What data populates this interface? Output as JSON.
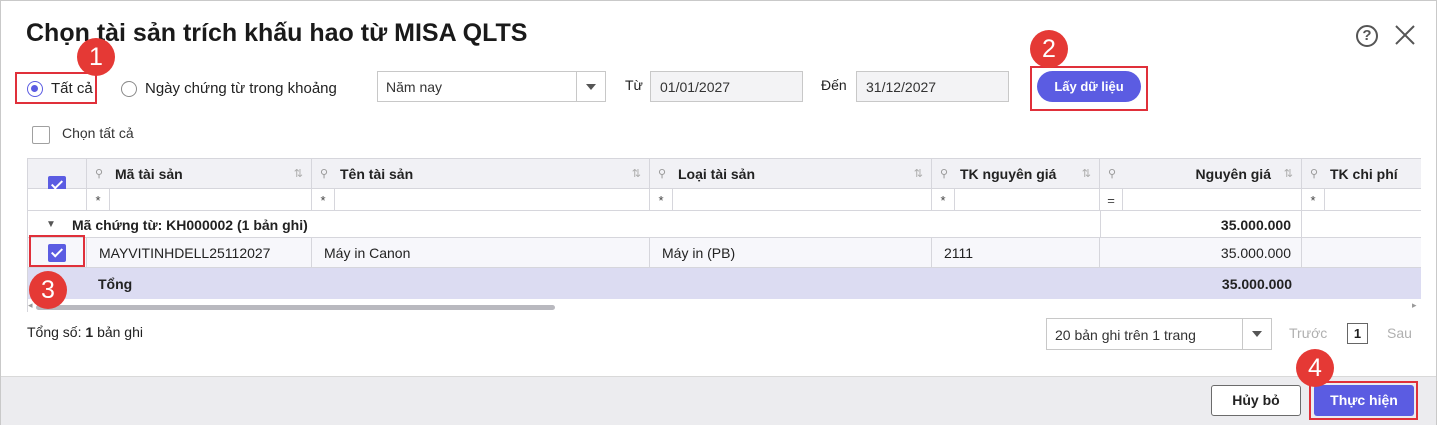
{
  "dialog": {
    "title": "Chọn tài sản trích khấu hao từ MISA QLTS",
    "help_icon": "question-circle-icon",
    "help_glyph": "?",
    "close_icon": "close-icon"
  },
  "filters": {
    "radio_all_label": "Tất cả",
    "radio_range_label": "Ngày chứng từ trong khoảng",
    "period_value": "Năm nay",
    "from_label": "Từ",
    "from_date": "01/01/2027",
    "to_label": "Đến",
    "to_date": "31/12/2027",
    "fetch_button": "Lấy dữ liệu"
  },
  "select_all_label": "Chọn tất cả",
  "grid": {
    "columns": [
      "Mã tài sản",
      "Tên tài sản",
      "Loại tài sản",
      "TK nguyên giá",
      "Nguyên giá",
      "TK chi phí"
    ],
    "filter_ops": [
      "*",
      "*",
      "*",
      "*",
      "=",
      "*"
    ],
    "group_label": "Mã chứng từ: KH000002 (1 bản ghi)",
    "group_total": "35.000.000",
    "row": {
      "checked": true,
      "ma_tai_san": "MAYVITINHDELL25112027",
      "ten_tai_san": "Máy in Canon",
      "loai_tai_san": "Máy in (PB)",
      "tk_nguyen_gia": "2111",
      "nguyen_gia": "35.000.000"
    },
    "total_label": "Tổng",
    "total_value": "35.000.000"
  },
  "summary": {
    "prefix": "Tổng số:",
    "count": "1",
    "suffix": "bản ghi"
  },
  "pagination": {
    "page_size": "20 bản ghi trên 1 trang",
    "prev": "Trước",
    "page": "1",
    "next": "Sau"
  },
  "footer": {
    "cancel": "Hủy bỏ",
    "submit": "Thực hiện"
  },
  "annotations": [
    "1",
    "2",
    "3",
    "4"
  ],
  "colors": {
    "accent": "#5b5ce2",
    "annotation_red": "#e53935",
    "total_row_bg": "#dcdcf2"
  }
}
